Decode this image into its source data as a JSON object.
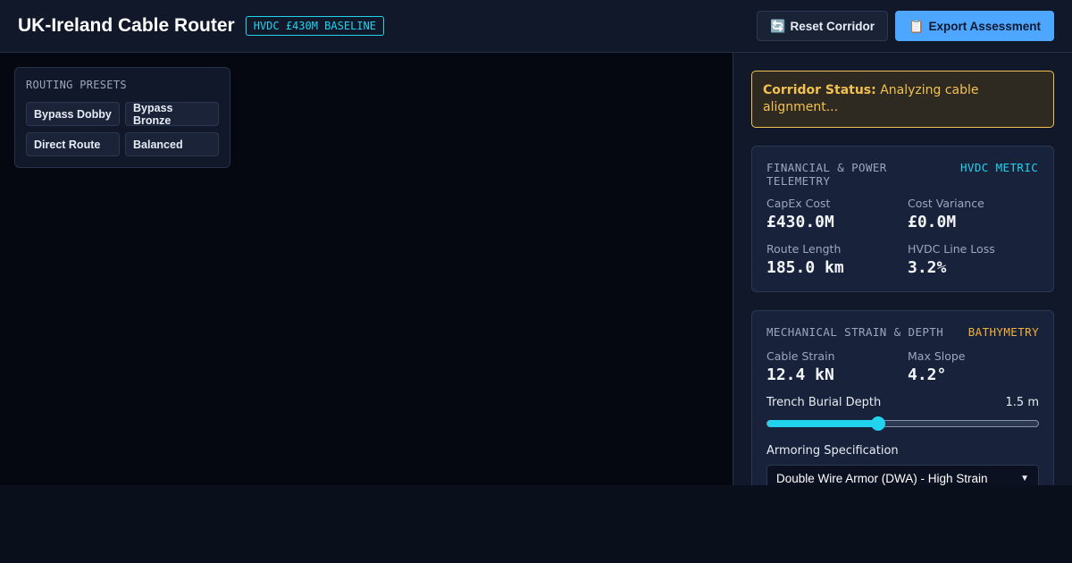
{
  "header": {
    "title": "UK-Ireland Cable Router",
    "badge": "HVDC £430M BASELINE",
    "reset_icon": "🔄",
    "reset_label": "Reset Corridor",
    "export_icon": "📋",
    "export_label": "Export Assessment"
  },
  "presets": {
    "title": "ROUTING PRESETS",
    "items": [
      "Bypass Dobby",
      "Bypass Bronze",
      "Direct Route",
      "Balanced"
    ]
  },
  "status": {
    "label": "Corridor Status:",
    "text": "Analyzing cable alignment..."
  },
  "financial": {
    "title": "FINANCIAL & POWER TELEMETRY",
    "tag": "HVDC METRIC",
    "metrics": [
      {
        "label": "CapEx Cost",
        "value": "£430.0M"
      },
      {
        "label": "Cost Variance",
        "value": "£0.0M"
      },
      {
        "label": "Route Length",
        "value": "185.0 km"
      },
      {
        "label": "HVDC Line Loss",
        "value": "3.2%"
      }
    ]
  },
  "mechanical": {
    "title": "MECHANICAL STRAIN & DEPTH",
    "tag": "BATHYMETRY",
    "metrics": [
      {
        "label": "Cable Strain",
        "value": "12.4 kN"
      },
      {
        "label": "Max Slope",
        "value": "4.2°"
      }
    ],
    "burial_label": "Trench Burial Depth",
    "burial_value": "1.5 m",
    "burial_fraction": 0.41,
    "armor_label": "Armoring Specification",
    "armor_selected": "Double Wire Armor (DWA) - High Strain"
  },
  "colors": {
    "accent_cyan": "#22d3ee",
    "accent_blue": "#4da6ff",
    "status_amber": "#f2c150"
  }
}
